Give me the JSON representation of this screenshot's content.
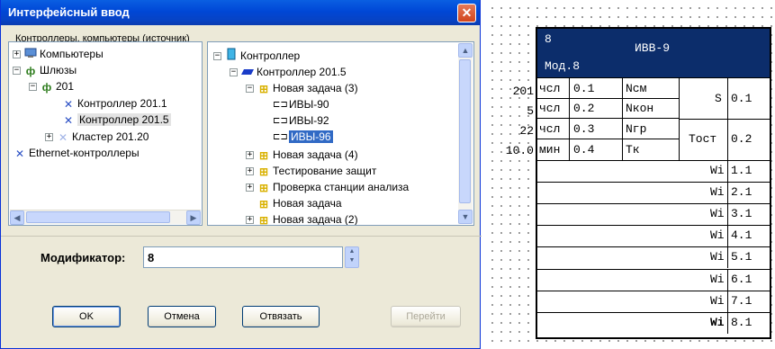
{
  "dialog": {
    "title": "Интерфейсный ввод",
    "group_label": "Контроллеры, компьютеры (источник)",
    "left_tree": [
      {
        "label": "Компьютеры",
        "icon": "computers-icon"
      },
      {
        "label": "Шлюзы",
        "icon": "gateway-icon"
      },
      {
        "label": "201",
        "icon": "gateway-icon"
      },
      {
        "label": "Контроллер 201.1",
        "icon": "controller-link-icon"
      },
      {
        "label": "Контроллер 201.5",
        "icon": "controller-link-icon"
      },
      {
        "label": "Кластер 201.20",
        "icon": "cluster-icon"
      },
      {
        "label": "Ethernet-контроллеры",
        "icon": "ethernet-icon"
      }
    ],
    "right_tree": [
      {
        "label": "Контроллер",
        "icon": "controller-icon"
      },
      {
        "label": "Контроллер 201.5",
        "icon": "controller-device-icon"
      },
      {
        "label": "Новая задача (3)",
        "icon": "task-icon"
      },
      {
        "label": "ИВЫ-90",
        "icon": "block-icon"
      },
      {
        "label": "ИВЫ-92",
        "icon": "block-icon"
      },
      {
        "label": "ИВЫ-96",
        "icon": "block-icon"
      },
      {
        "label": "Новая задача (4)",
        "icon": "task-icon"
      },
      {
        "label": "Тестирование защит",
        "icon": "task-icon"
      },
      {
        "label": "Проверка станции анализа",
        "icon": "task-icon"
      },
      {
        "label": "Новая задача",
        "icon": "task-icon"
      },
      {
        "label": "Новая задача (2)",
        "icon": "task-icon"
      }
    ],
    "modifier_label": "Модификатор:",
    "modifier_value": "8",
    "buttons": {
      "ok": "OK",
      "cancel": "Отмена",
      "unbind": "Отвязать",
      "goto": "Перейти"
    }
  },
  "block": {
    "number": "8",
    "name": "ИВВ-9",
    "mod": "Мод.8",
    "inputs": [
      {
        "outer_value": "201",
        "type": "чсл",
        "id": "0.1",
        "param": "Nсм"
      },
      {
        "outer_value": "5",
        "type": "чсл",
        "id": "0.2",
        "param": "Nкон"
      },
      {
        "outer_value": "22",
        "type": "чсл",
        "id": "0.3",
        "param": "Nгр"
      },
      {
        "outer_value": "10.0",
        "type": "мин",
        "id": "0.4",
        "param": "Тк"
      }
    ],
    "outputs_top": [
      {
        "label": "S",
        "id": "0.1"
      },
      {
        "label": "Тост",
        "id": "0.2"
      }
    ],
    "wi_rows": [
      {
        "label": "Wi",
        "id": "1.1"
      },
      {
        "label": "Wi",
        "id": "2.1"
      },
      {
        "label": "Wi",
        "id": "3.1"
      },
      {
        "label": "Wi",
        "id": "4.1"
      },
      {
        "label": "Wi",
        "id": "5.1"
      },
      {
        "label": "Wi",
        "id": "6.1"
      },
      {
        "label": "Wi",
        "id": "7.1"
      },
      {
        "label": "Wi",
        "id": "8.1"
      }
    ]
  },
  "colors": {
    "block_header": "#0c2d6b",
    "selection": "#316ac5",
    "title_bar": "#0047d6"
  }
}
